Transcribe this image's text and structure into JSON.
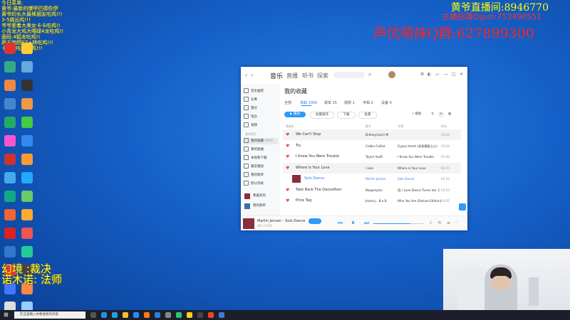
{
  "chat": {
    "lines": [
      "今日菜单:",
      "黄爷:最新的爆甲巴德佐伊",
      "黄爷的长大最棒朋友吃鸡!!!",
      "3-5跳出鸡!!!",
      "爷爷爱着大美女卡卡吃鸡!!",
      "小青龙大鸡大噶绿4龙吃鸡!!",
      "面码.4狐龙吃鸡!!",
      "萨王炮鸽EZ+林吃鸡!!!",
      "卡飞狗吃鸡吃鸡!!!"
    ],
    "caption1": "幻境 :裁决",
    "caption2": "诺木诺: 法师"
  },
  "stream": {
    "room_label": "黄爷直播间:",
    "room_number": "8946770",
    "qq_line": "主播招募Qgun:753490551",
    "group_label": "声优萌妹Q群:",
    "group_number": "627899300"
  },
  "music": {
    "nav": [
      "音乐",
      "直播",
      "听书",
      "探索"
    ],
    "page_title": "我的收藏",
    "tabs": [
      "全部",
      "单曲 1000",
      "歌单 15",
      "视频 1",
      "专辑 2",
      "设备 0"
    ],
    "buttons": {
      "play_all": "播放",
      "add": "批量操作",
      "download": "下载",
      "batch": "批量",
      "search": "搜索"
    },
    "headers": [
      "歌曲名",
      "歌手",
      "专辑",
      "时长"
    ],
    "sidebar": {
      "items": [
        "音乐推荐",
        "乐库",
        "雷达",
        "电台",
        "视频"
      ],
      "section_mine": "我的音乐",
      "my_items": [
        "我的收藏",
        "我的歌曲",
        "本地和下载",
        "最近播放",
        "我的歌单",
        "默认列表"
      ],
      "fav_count": "1000",
      "playlists": [
        "我喜欢的",
        "我的歌单"
      ]
    },
    "rows": [
      {
        "title": "We Can't Stop",
        "artist": "Britney/Lee少爷",
        "album": "",
        "duration": "03:34"
      },
      {
        "title": "Try",
        "artist": "Colbie Caillat",
        "album": "Gypsy Heart (发现最爱之心)",
        "duration": "03:44"
      },
      {
        "title": "I Knew You Were Trouble",
        "artist": "Taylor Swift",
        "album": "I Knew You Were Trouble",
        "duration": "03:40"
      },
      {
        "title": "Where Is Your Love",
        "artist": "I Like",
        "album": "Where is Your Love",
        "duration": "03:47"
      },
      {
        "title": "Solo Dance",
        "artist": "Martin Jensen",
        "album": "Solo Dance",
        "duration": "02:54"
      },
      {
        "title": "Take Back The Dancefloor",
        "artist": "Megastylez",
        "album": "DJ / Love Dance Tunes Vol. 1",
        "duration": "03:53"
      },
      {
        "title": "Price Tag",
        "artist": "Jessie J、B.o.B",
        "album": "Who You Are (Deluxe Edition)",
        "duration": "04:05"
      }
    ],
    "player": {
      "now_playing": "Martin Jensen - Solo Dance",
      "time": "00 | 2:54"
    }
  },
  "taskbar": {
    "search_placeholder": "在这里输入你要搜索的内容"
  }
}
